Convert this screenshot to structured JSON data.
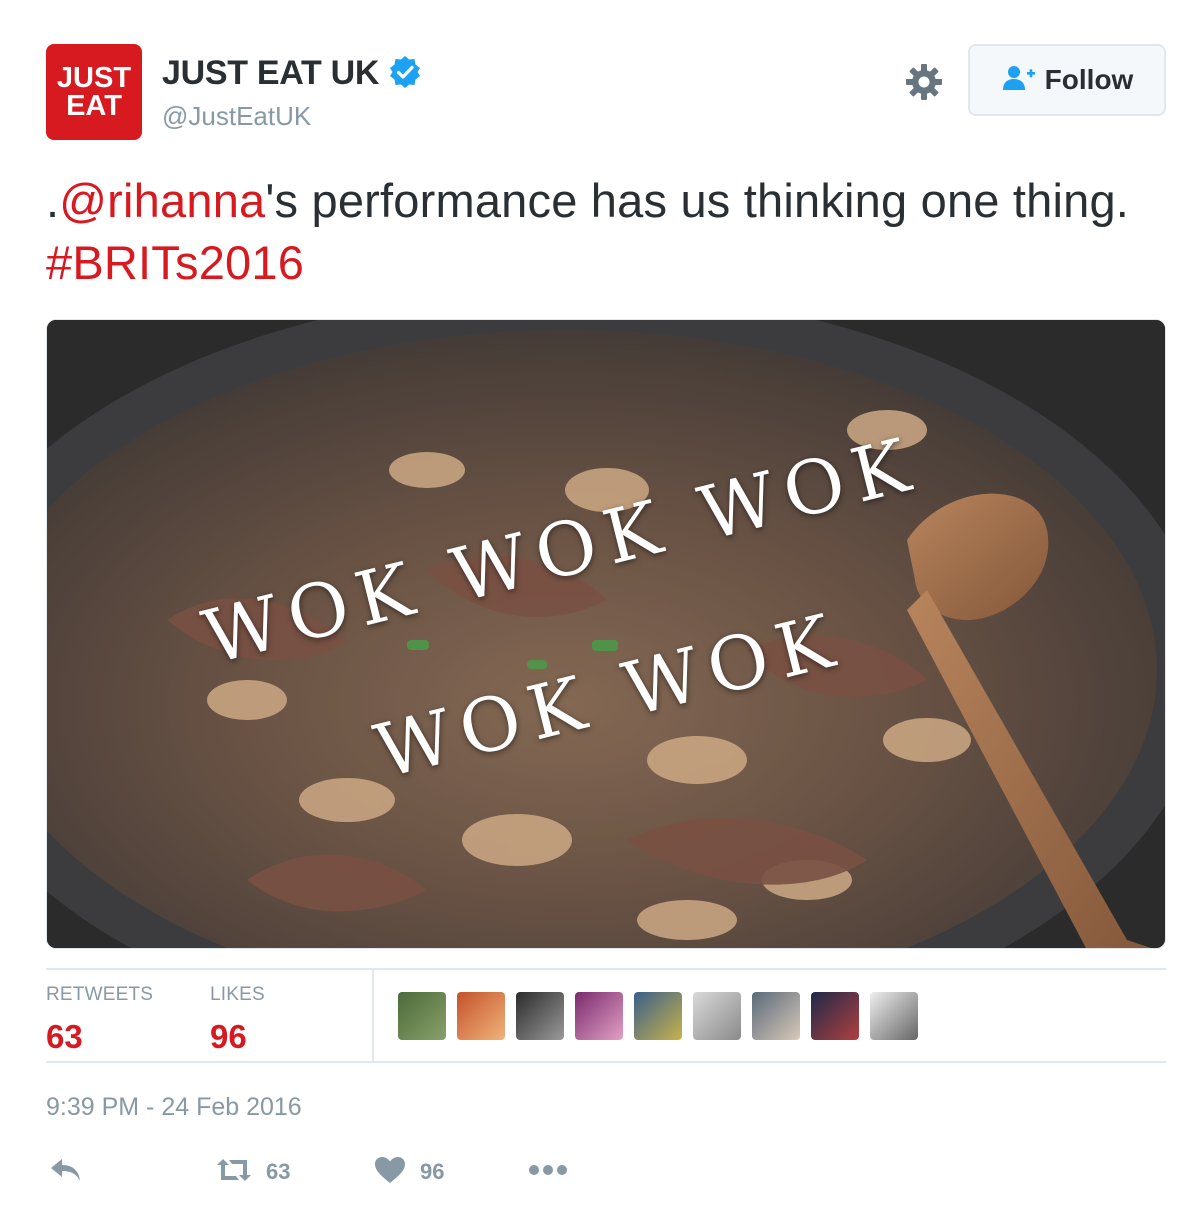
{
  "header": {
    "avatar_logo_lines": [
      "JUST",
      "EAT"
    ],
    "display_name": "JUST EAT UK",
    "handle": "@JustEatUK",
    "verified_icon": "verified-badge-icon",
    "settings_icon": "gear-icon",
    "follow_label": "Follow",
    "follow_icon": "add-user-icon"
  },
  "tweet": {
    "prefix": ".",
    "mention": "@rihanna",
    "text_mid": "'s performance has us thinking one thing. ",
    "hashtag": "#BRITs2016"
  },
  "media": {
    "overlay_line1": "WOK WOK WOK",
    "overlay_line2": "WOK WOK"
  },
  "stats": {
    "retweets_label": "RETWEETS",
    "retweets_value": "63",
    "likes_label": "LIKES",
    "likes_value": "96",
    "liker_avatar_count": 9
  },
  "timestamp": "9:39 PM - 24 Feb 2016",
  "actions": {
    "reply_icon": "reply-icon",
    "retweet_icon": "retweet-icon",
    "retweet_count": "63",
    "like_icon": "heart-icon",
    "like_count": "96",
    "more_icon": "more-dots-icon"
  },
  "colors": {
    "brand_red": "#d71920",
    "verified_blue": "#1da1f2",
    "muted_gray": "#8899a6",
    "text_dark": "#292f33"
  }
}
